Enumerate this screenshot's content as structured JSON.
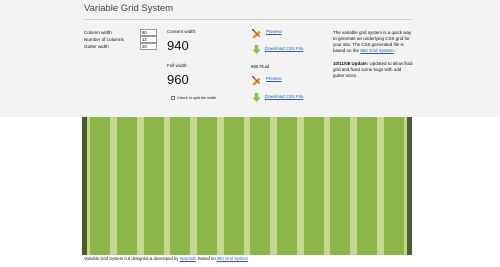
{
  "page": {
    "title": "Variable Grid System"
  },
  "form": {
    "column_width": {
      "label": "Column width",
      "value": "60"
    },
    "num_columns": {
      "label": "Number of columns",
      "value": "12"
    },
    "gutter_width": {
      "label": "Gutter width",
      "value": "20"
    }
  },
  "content": {
    "content_width_label": "Content width:",
    "content_width_value": "940",
    "full_width_label": "Full width:",
    "full_width_value": "960",
    "split_label": "Check to split the width"
  },
  "actions": {
    "preview_label": "Preview",
    "download_label": "Download CSS File",
    "fluid_heading": "960 Fluid",
    "preview_fluid_label": "Preview",
    "download_fluid_label": "Download CSS File"
  },
  "sidebar": {
    "intro_text": "The variable grid system is a quick way to generate an underlying CSS grid for your site. The CSS generated file is based on the ",
    "intro_link": "960 Grid System",
    "intro_end": ".",
    "update_date": "10/11/08 Update:",
    "update_text": " Updated to allow fluid grid and fixed some bugs with odd gutter sizes."
  },
  "grid": {
    "columns": 12,
    "column_width": 60,
    "gutter_width": 20
  },
  "footer": {
    "prefix": "Variable Grid System 0.8 designed & developed by ",
    "author_link": "SprySoft",
    "middle": ". Based on ",
    "based_link": "960 Grid System"
  },
  "colors": {
    "column": "#8cb54a",
    "gutter": "#c6d88c",
    "edge": "#4d5b33",
    "link": "#2a5fb4"
  },
  "icons": {
    "edit": "pencil-ruler-icon",
    "download": "download-arrow-icon"
  }
}
